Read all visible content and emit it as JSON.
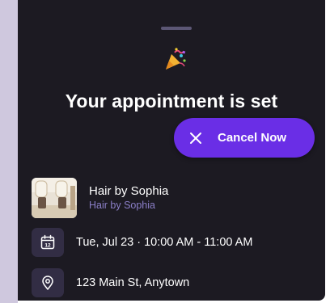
{
  "sheet": {
    "title": "Your appointment is set",
    "celebration_icon": "party-popper-icon",
    "cancel_button": {
      "label": "Cancel Now",
      "icon": "close-icon"
    },
    "salon": {
      "name": "Hair by Sophia",
      "subtitle": "Hair by Sophia"
    },
    "date": {
      "icon": "calendar-icon",
      "calendar_day": "12",
      "text": "Tue, Jul 23 · 10:00 AM - 11:00 AM"
    },
    "location": {
      "icon": "map-pin-icon",
      "text": "123 Main St, Anytown"
    }
  },
  "colors": {
    "sheet_background": "#1c1a22",
    "accent": "#6a2ee6",
    "subtitle": "#8b7fc8",
    "icon_box": "#322d44"
  }
}
